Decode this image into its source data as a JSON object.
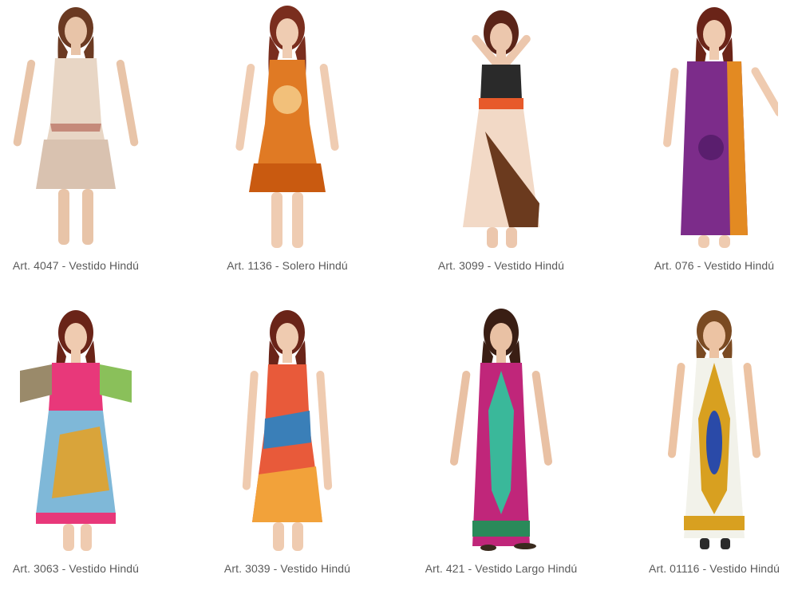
{
  "products": [
    {
      "caption": "Art. 4047 - Vestido Hindú",
      "colors": {
        "main": "#e8d6c5",
        "accent": "#c58a7a",
        "hem": "#d9c2b0"
      }
    },
    {
      "caption": "Art. 1136 - Solero Hindú",
      "colors": {
        "main": "#e07a24",
        "accent": "#f2c07a",
        "hem": "#c95a10"
      }
    },
    {
      "caption": "Art. 3099 - Vestido Hindú",
      "colors": {
        "main": "#f2d9c6",
        "accent": "#6b3a1e",
        "hem": "#e75a2a"
      }
    },
    {
      "caption": "Art. 076 - Vestido Hindú",
      "colors": {
        "main": "#7c2c8a",
        "accent": "#e38a22",
        "hem": "#5a1e6e"
      }
    },
    {
      "caption": "Art. 3063 - Vestido Hindú",
      "colors": {
        "main": "#7fb8d8",
        "accent": "#d9a43a",
        "hem": "#e8387a"
      }
    },
    {
      "caption": "Art. 3039 - Vestido Hindú",
      "colors": {
        "main": "#e85a3a",
        "accent": "#3a7fb8",
        "hem": "#f2a23a"
      }
    },
    {
      "caption": "Art. 421 - Vestido Largo Hindú",
      "colors": {
        "main": "#c0267a",
        "accent": "#3ab89a",
        "hem": "#2a8a5a"
      }
    },
    {
      "caption": "Art. 01116 - Vestido Hindú",
      "colors": {
        "main": "#f2f2ea",
        "accent": "#d8a020",
        "hem": "#2a4aa8"
      }
    }
  ]
}
